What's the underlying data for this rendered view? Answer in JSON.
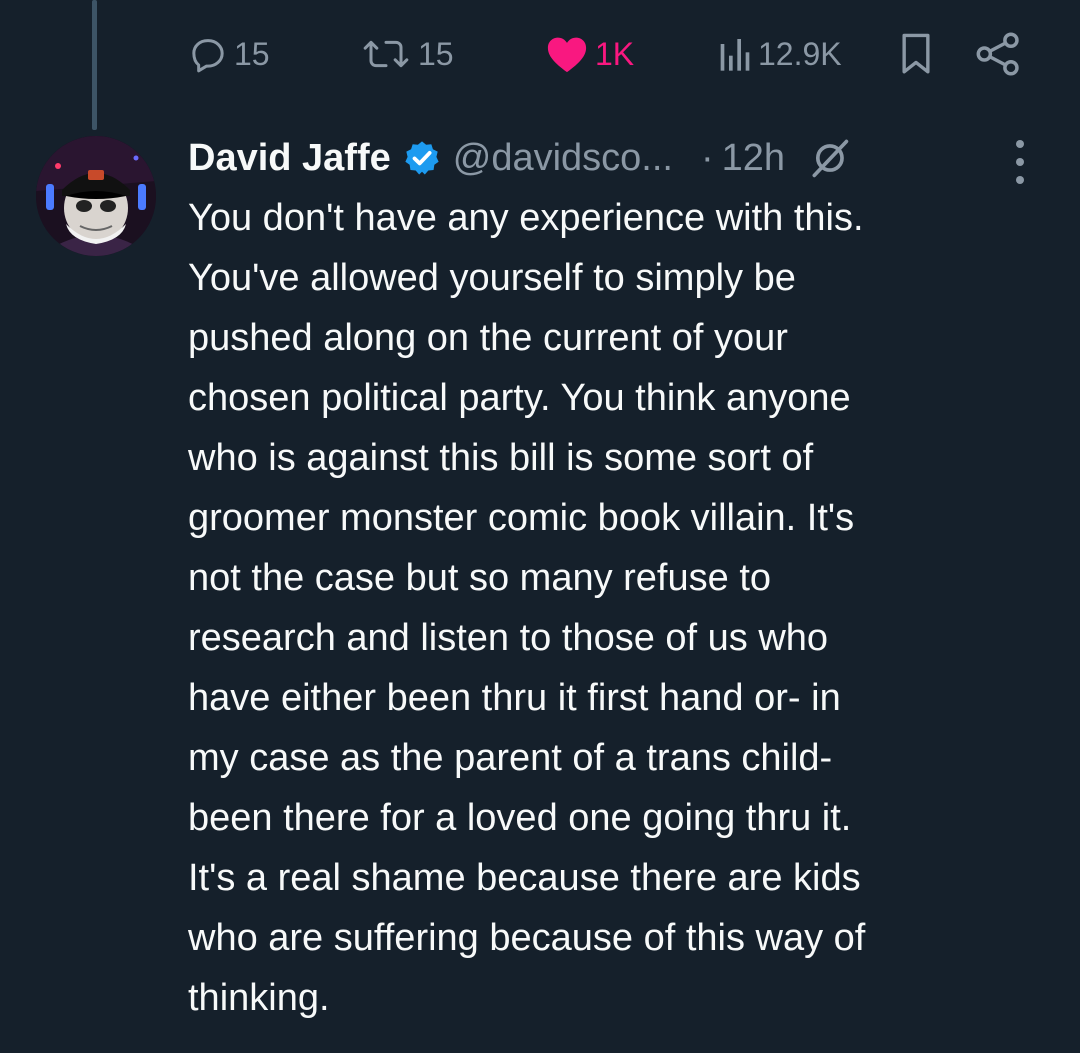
{
  "actions": {
    "replies": "15",
    "reposts": "15",
    "likes": "1K",
    "views": "12.9K"
  },
  "colors": {
    "background": "#15202b",
    "muted": "#8b98a5",
    "like": "#f91880",
    "verified": "#1d9bf0",
    "text": "#f7f9f9"
  },
  "tweet": {
    "author_name": "David Jaffe",
    "handle": "@davidsco...",
    "separator": "·",
    "time": "12h",
    "verified_icon": "verified-badge-icon",
    "lines": [
      "You don't have any experience with this.",
      "You've allowed yourself to simply be",
      "pushed along on the current of your",
      "chosen political party. You think anyone",
      "who is against this bill is some sort of",
      "groomer monster comic book villain. It's",
      "not the case but so many refuse to",
      "research and listen to those of us who",
      "have either been thru it first hand or- in",
      "my case as the parent of a trans child-",
      "been there for a loved one going thru it.",
      "It's a real shame because there are kids",
      "who are suffering because of this way of",
      "thinking."
    ]
  }
}
